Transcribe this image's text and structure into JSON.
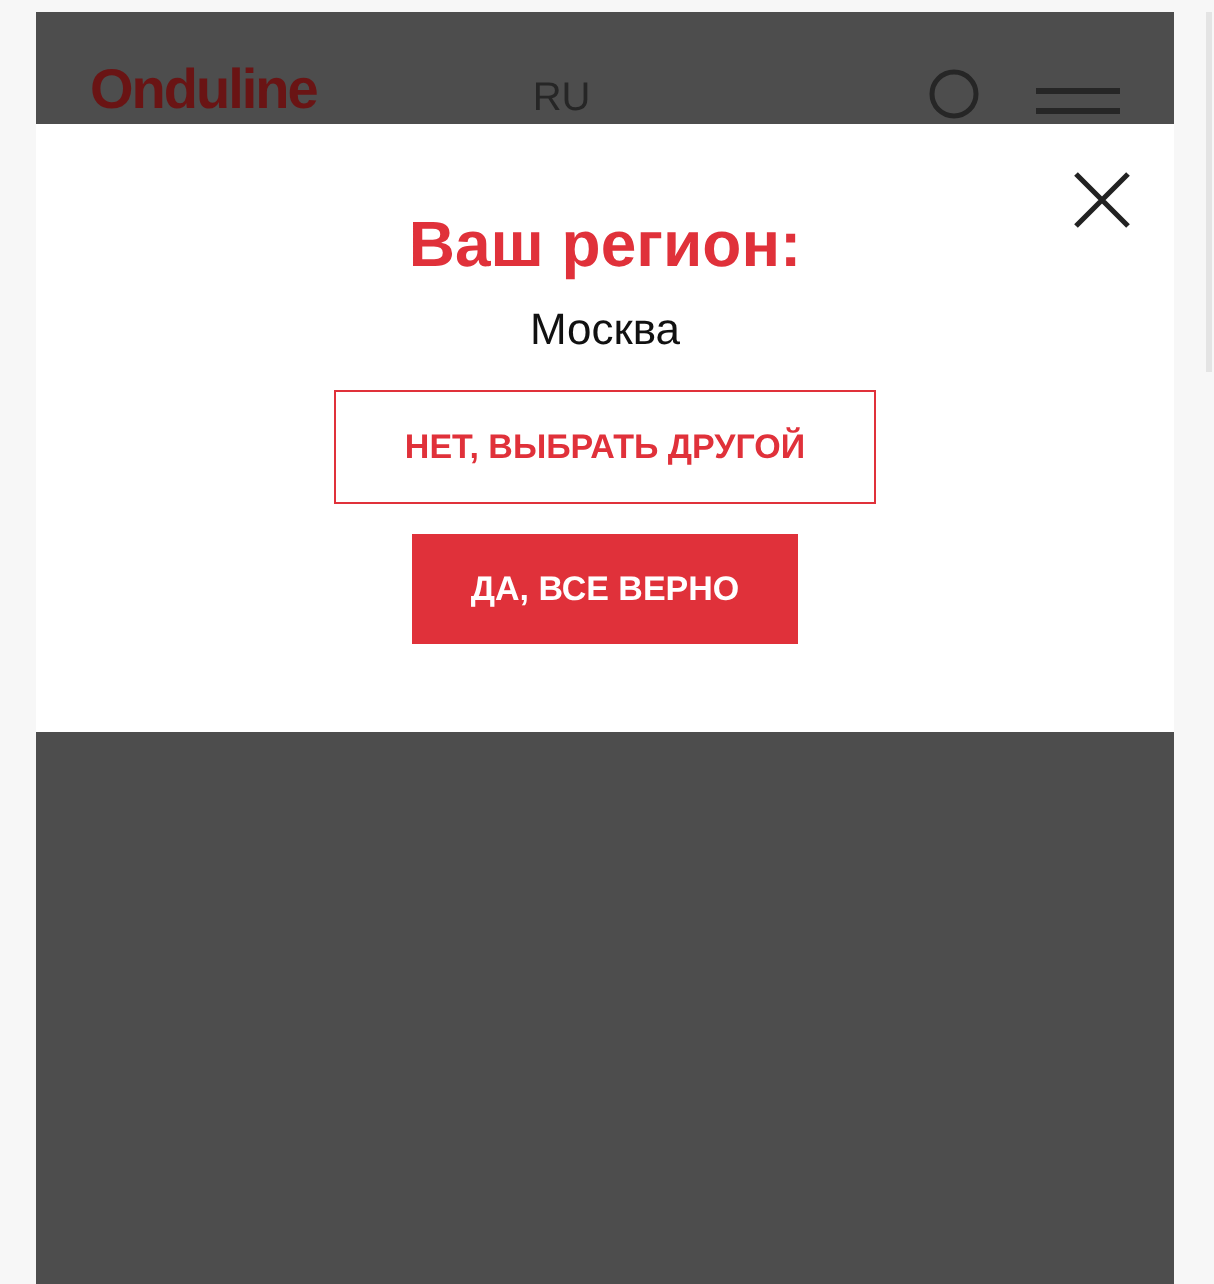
{
  "header": {
    "logo": "Onduline",
    "language": "RU"
  },
  "region_dialog": {
    "title": "Ваш регион:",
    "region": "Москва",
    "buttons": [
      {
        "label": "НЕТ, ВЫБРАТЬ ДРУГОЙ",
        "kind": "outline"
      },
      {
        "label": "ДА, ВСЕ ВЕРНО",
        "kind": "filled"
      }
    ]
  }
}
